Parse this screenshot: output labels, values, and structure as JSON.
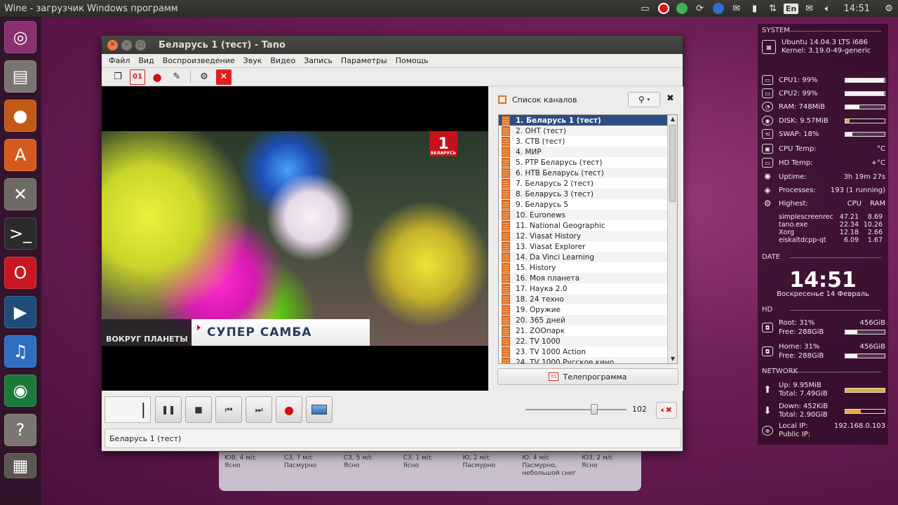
{
  "top_panel": {
    "app_title": "Wine - загрузчик Windows программ",
    "lang": "En",
    "clock": "14:51"
  },
  "window": {
    "title": "Беларусь 1 (тест) - Tano",
    "menu": [
      "Файл",
      "Вид",
      "Воспроизведение",
      "Звук",
      "Видео",
      "Запись",
      "Параметры",
      "Помощь"
    ]
  },
  "video": {
    "logo_text": "1",
    "logo_sub": "БЕЛАРУСЬ",
    "lower_left": "ВОКРУГ ПЛАНЕТЫ",
    "lower_title": "СУПЕР САМБА"
  },
  "channels": {
    "title": "Список каналов",
    "items": [
      "1.  Беларусь 1 (тест)",
      "2.  ОНТ (тест)",
      "3.  СТВ (тест)",
      "4.  МИР",
      "5.  РТР Беларусь (тест)",
      "6.  НТВ Беларусь (тест)",
      "7.  Беларусь 2 (тест)",
      "8.  Беларусь 3 (тест)",
      "9.  Беларусь 5",
      "10.  Euronews",
      "11.  National Geographic",
      "12.  Viasat History",
      "13.  Viasat Explorer",
      "14.  Da Vinci Learning",
      "15.  History",
      "16.  Моя планета",
      "17.  Наука 2.0",
      "18.  24 техно",
      "19.  Оружие",
      "20.  365 дней",
      "21.  ZOOпарк",
      "22.  TV 1000",
      "23.  TV 1000 Action",
      "24.  TV 1000 Русское кино"
    ],
    "epg_button": "Телепрограмма",
    "epg_icon_text": "01"
  },
  "controls": {
    "volume": 102,
    "volume_max": 150
  },
  "status": {
    "text": "Беларусь 1 (тест)"
  },
  "weather": [
    {
      "wind": "ЮВ, 4 м/с",
      "desc": "Ясно"
    },
    {
      "wind": "СЗ, 7 м/с",
      "desc": "Пасмурно"
    },
    {
      "wind": "СЗ, 5 м/с",
      "desc": "Ясно"
    },
    {
      "wind": "СЗ, 1 м/с",
      "desc": "Ясно"
    },
    {
      "wind": "Ю, 2 м/с",
      "desc": "Пасмурно"
    },
    {
      "wind": "Ю, 4 м/с",
      "desc": "Пасмурно, небольшой снег"
    },
    {
      "wind": "ЮЗ, 2 м/с",
      "desc": "Ясно"
    }
  ],
  "conky": {
    "system_label": "SYSTEM",
    "os": "Ubuntu 14.04.3 LTS i686",
    "kernel": "Kernel: 3.19.0-49-generic",
    "rows": [
      {
        "label": "CPU1: 99%",
        "value": "",
        "fill": 0.99
      },
      {
        "label": "CPU2: 99%",
        "value": "",
        "fill": 0.99
      },
      {
        "label": "RAM: 748MiB",
        "value": "",
        "fill": 0.35
      },
      {
        "label": "DISK: 9.57MiB",
        "value": "",
        "fill": 0.1
      },
      {
        "label": "SWAP: 18%",
        "value": "",
        "fill": 0.18
      },
      {
        "label": "CPU Temp:",
        "value": "°C"
      },
      {
        "label": "HD Temp:",
        "value": "+°C"
      },
      {
        "label": "Uptime:",
        "value": "3h 19m 27s"
      },
      {
        "label": "Processes:",
        "value": "193 (1 running)"
      }
    ],
    "highest_label": "Highest:",
    "highest_cpu": "CPU",
    "highest_ram": "RAM",
    "processes": [
      {
        "name": "simplescreenrec",
        "cpu": "47.21",
        "ram": "8.69"
      },
      {
        "name": "tano.exe",
        "cpu": "22.34",
        "ram": "10.26"
      },
      {
        "name": "Xorg",
        "cpu": "12.18",
        "ram": "2.66"
      },
      {
        "name": "eiskaltdcpp-qt",
        "cpu": "6.09",
        "ram": "1.67"
      }
    ],
    "date_label": "DATE",
    "time": "14:51",
    "date": "Воскресенье 14 Февраль",
    "hd_label": "HD",
    "root_used": "Root: 31%",
    "root_size": "456GiB",
    "root_free": "Free: 288GiB",
    "root_fill": 0.31,
    "home_used": "Home: 31%",
    "home_size": "456GiB",
    "home_free": "Free: 288GiB",
    "home_fill": 0.31,
    "network_label": "NETWORK",
    "up": "Up: 9.95MiB",
    "up_total": "Total: 7.49GiB",
    "down": "Down: 452KiB",
    "down_total": "Total: 2.90GiB",
    "local_ip_label": "Local IP:",
    "local_ip": "192.168.0.103",
    "public_ip_label": "Public IP:"
  }
}
